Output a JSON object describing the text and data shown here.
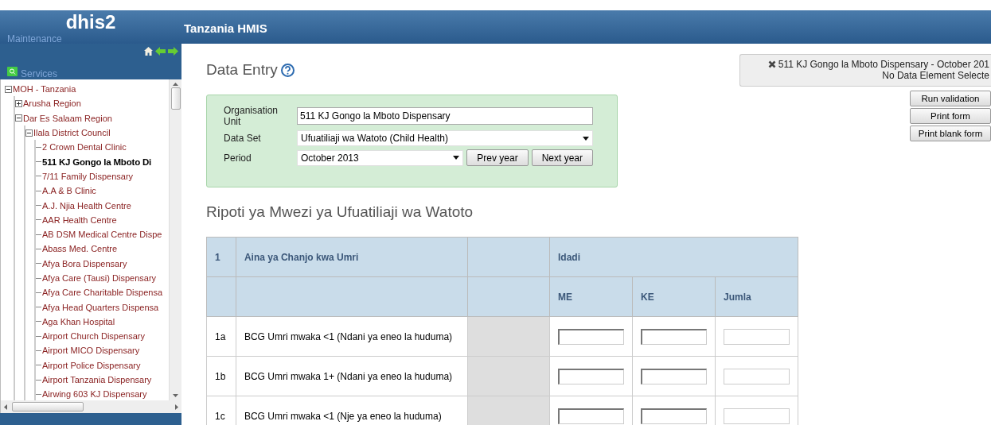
{
  "header": {
    "logo": "dhis2",
    "title": "Tanzania HMIS"
  },
  "menu": [
    "Maintenance",
    "Services"
  ],
  "tree": [
    {
      "label": "MOH - Tanzania",
      "expanded": true,
      "selected": false,
      "children": [
        {
          "label": "Arusha Region",
          "expanded": false,
          "selected": false
        },
        {
          "label": "Dar Es Salaam Region",
          "expanded": true,
          "selected": false,
          "children": [
            {
              "label": "Ilala District Council",
              "expanded": true,
              "selected": false,
              "children": [
                {
                  "label": "2 Crown Dental Clinic",
                  "selected": false
                },
                {
                  "label": "511 KJ Gongo la Mboto Di",
                  "selected": true
                },
                {
                  "label": "7/11 Family Dispensary",
                  "selected": false
                },
                {
                  "label": "A.A & B Clinic",
                  "selected": false
                },
                {
                  "label": "A.J. Njia Health Centre",
                  "selected": false
                },
                {
                  "label": "AAR Health Centre",
                  "selected": false
                },
                {
                  "label": "AB DSM Medical Centre Dispe",
                  "selected": false
                },
                {
                  "label": "Abass Med. Centre",
                  "selected": false
                },
                {
                  "label": "Afya Bora Dispensary",
                  "selected": false
                },
                {
                  "label": "Afya Care (Tausi) Dispensary",
                  "selected": false
                },
                {
                  "label": "Afya Care Charitable Dispensa",
                  "selected": false
                },
                {
                  "label": "Afya Head Quarters Dispensa",
                  "selected": false
                },
                {
                  "label": "Aga Khan Hospital",
                  "selected": false
                },
                {
                  "label": "Airport Church Dispensary",
                  "selected": false
                },
                {
                  "label": "Airport MICO Dispensary",
                  "selected": false
                },
                {
                  "label": "Airport Police Dispensary",
                  "selected": false
                },
                {
                  "label": "Airport Tanzania Dispensary",
                  "selected": false
                },
                {
                  "label": "Airwing 603 KJ Dispensary",
                  "selected": false
                }
              ]
            }
          ]
        }
      ]
    }
  ],
  "page": {
    "title": "Data Entry"
  },
  "selection": {
    "fields": [
      {
        "kind": "text",
        "label": "Organisation Unit",
        "value": "511 KJ Gongo la Mboto Dispensary"
      },
      {
        "kind": "select",
        "label": "Data Set",
        "value": "Ufuatiliaji wa Watoto (Child Health)"
      },
      {
        "kind": "select",
        "label": "Period",
        "value": "October 2013",
        "buttons": [
          "Prev year",
          "Next year"
        ]
      }
    ]
  },
  "info": {
    "line1": "511 KJ Gongo la Mboto Dispensary - October 201",
    "line2": "No Data Element Selecte"
  },
  "actions": [
    "Run validation",
    "Print form",
    "Print blank form"
  ],
  "form": {
    "title": "Ripoti ya Mwezi ya Ufuatiliaji wa Watoto",
    "header1": [
      "1",
      "Aina ya Chanjo kwa Umri",
      "Idadi"
    ],
    "header2": [
      "ME",
      "KE",
      "Jumla"
    ],
    "rows": [
      {
        "code": "1a",
        "label": "BCG Umri mwaka <1 (Ndani ya eneo la huduma)"
      },
      {
        "code": "1b",
        "label": "BCG Umri mwaka 1+ (Ndani ya eneo la huduma)"
      },
      {
        "code": "1c",
        "label": "BCG Umri mwaka <1 (Nje ya eneo la huduma)"
      }
    ]
  }
}
